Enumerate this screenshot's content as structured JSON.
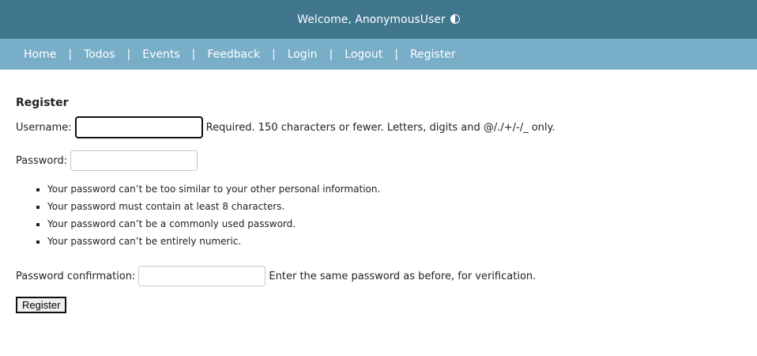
{
  "header": {
    "welcome_text": "Welcome, AnonymousUser",
    "theme_toggle_icon": "contrast-icon"
  },
  "nav": {
    "items": [
      {
        "label": "Home"
      },
      {
        "label": "Todos"
      },
      {
        "label": "Events"
      },
      {
        "label": "Feedback"
      },
      {
        "label": "Login"
      },
      {
        "label": "Logout"
      },
      {
        "label": "Register"
      }
    ],
    "separator": "|"
  },
  "form": {
    "title": "Register",
    "username": {
      "label": "Username:",
      "value": "",
      "help": "Required. 150 characters or fewer. Letters, digits and @/./+/-/_ only."
    },
    "password": {
      "label": "Password:",
      "value": "",
      "rules": [
        "Your password can’t be too similar to your other personal information.",
        "Your password must contain at least 8 characters.",
        "Your password can’t be a commonly used password.",
        "Your password can’t be entirely numeric."
      ]
    },
    "password_confirmation": {
      "label": "Password confirmation:",
      "value": "",
      "help": "Enter the same password as before, for verification."
    },
    "submit_label": "Register"
  },
  "colors": {
    "header_bg": "#41768f",
    "nav_bg": "#79aec8"
  }
}
